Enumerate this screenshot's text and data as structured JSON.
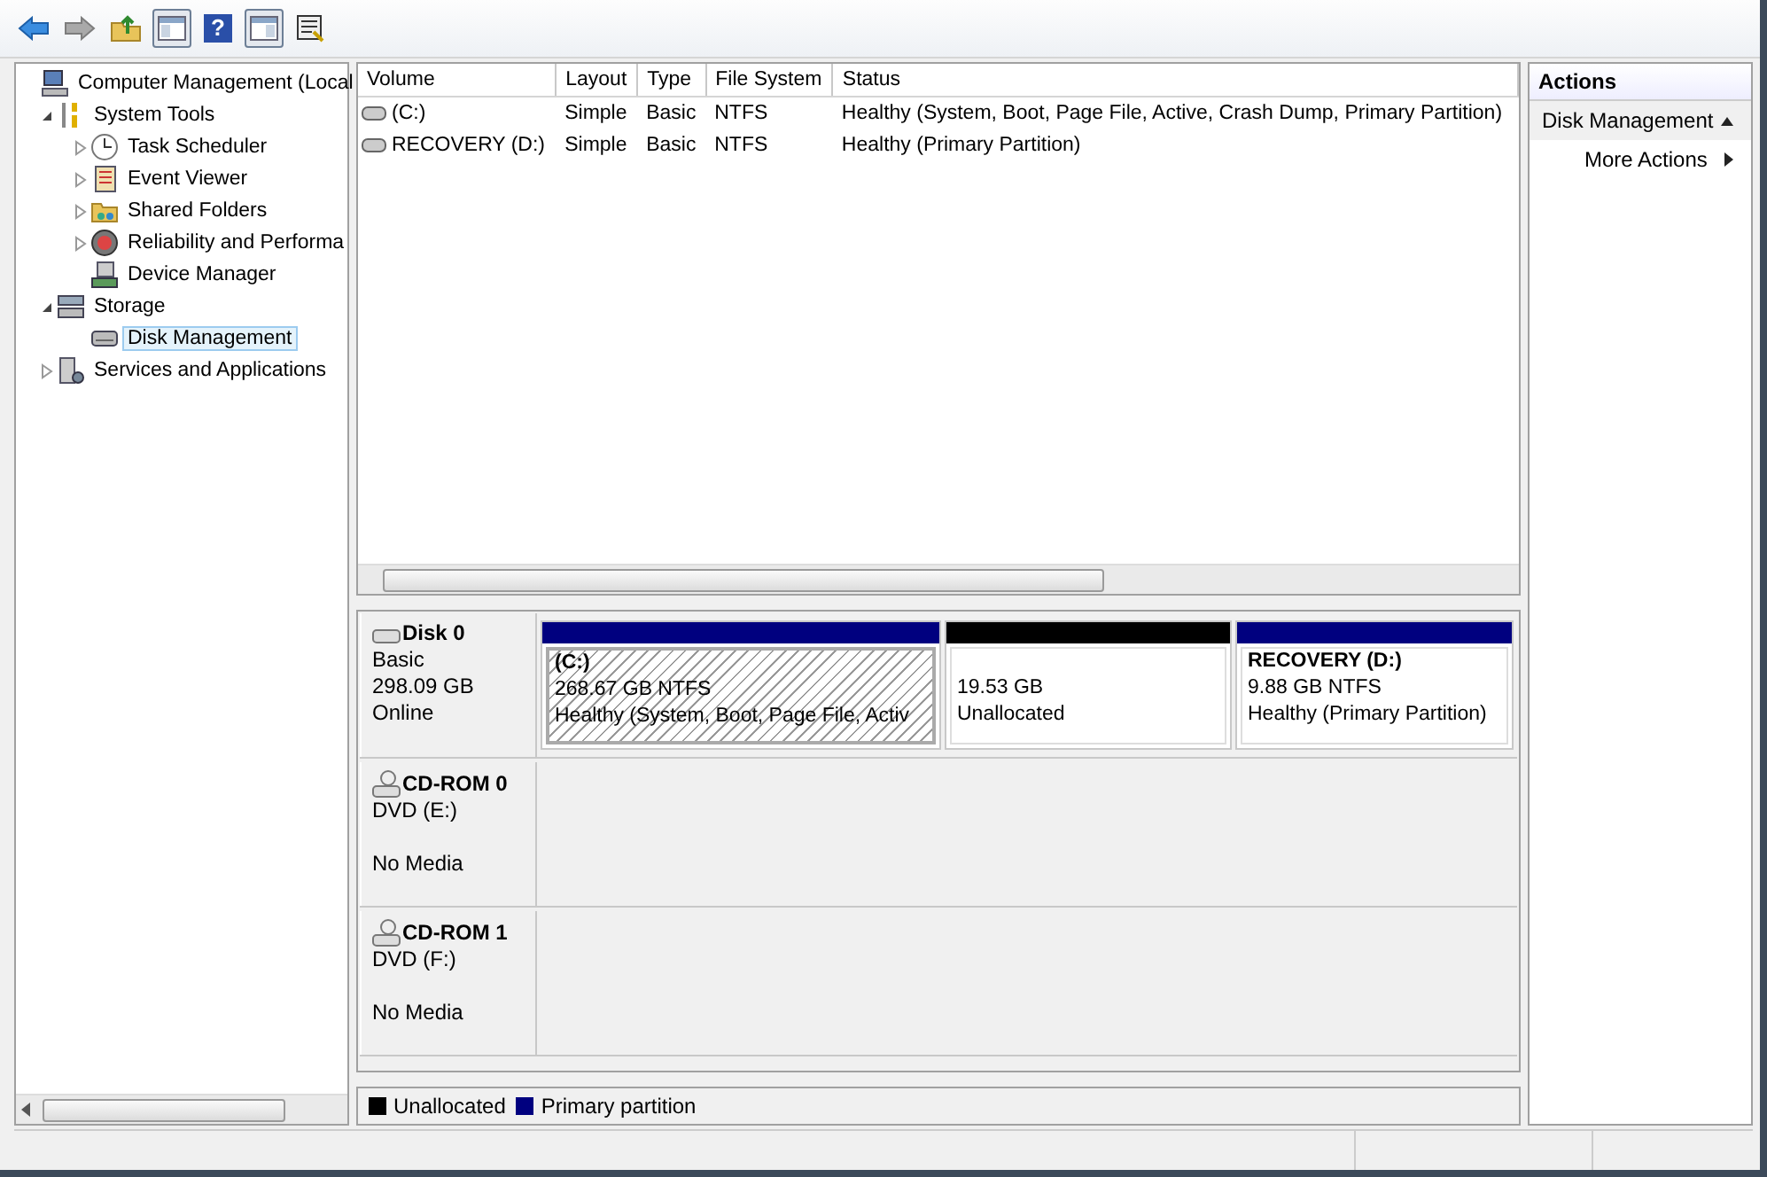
{
  "toolbar": {
    "buttons": [
      {
        "kind": "back",
        "pressed": false
      },
      {
        "kind": "forward",
        "pressed": false
      },
      {
        "kind": "up",
        "pressed": false
      },
      {
        "kind": "tree-toggle",
        "pressed": true
      },
      {
        "kind": "help",
        "pressed": false,
        "glyph": "?"
      },
      {
        "kind": "pane-toggle",
        "pressed": true
      },
      {
        "kind": "properties",
        "pressed": false
      }
    ]
  },
  "tree": {
    "items": [
      {
        "label": "Computer Management (Local",
        "kind": "computer",
        "selected": false,
        "children": [
          {
            "label": "System Tools",
            "kind": "tools",
            "expanded": true,
            "selected": false,
            "children": [
              {
                "label": "Task Scheduler",
                "kind": "clock",
                "expanded": false,
                "selected": false
              },
              {
                "label": "Event Viewer",
                "kind": "log",
                "expanded": false,
                "selected": false
              },
              {
                "label": "Shared Folders",
                "kind": "folder",
                "expanded": false,
                "selected": false
              },
              {
                "label": "Reliability and Performa",
                "kind": "gauge",
                "expanded": false,
                "selected": false
              },
              {
                "label": "Device Manager",
                "kind": "device",
                "selected": false
              }
            ]
          },
          {
            "label": "Storage",
            "kind": "storage",
            "expanded": true,
            "selected": false,
            "children": [
              {
                "label": "Disk Management",
                "kind": "disk",
                "selected": true
              }
            ]
          },
          {
            "label": "Services and Applications",
            "kind": "services",
            "expanded": false,
            "selected": false
          }
        ]
      }
    ]
  },
  "volumes": {
    "columns": [
      "Volume",
      "Layout",
      "Type",
      "File System",
      "Status"
    ],
    "rows": [
      [
        "(C:)",
        "Simple",
        "Basic",
        "NTFS",
        "Healthy (System, Boot, Page File, Active, Crash Dump, Primary Partition)"
      ],
      [
        "RECOVERY (D:)",
        "Simple",
        "Basic",
        "NTFS",
        "Healthy (Primary Partition)"
      ]
    ]
  },
  "disks": [
    {
      "kind": "disk",
      "name": "Disk 0",
      "lines": [
        "Basic",
        "298.09 GB"
      ],
      "state": "Online",
      "partitions": [
        {
          "color": "#00007f",
          "name": "(C:)",
          "size": "268.67 GB NTFS",
          "status": "Healthy (System, Boot, Page File, Activ",
          "selected": true
        },
        {
          "color": "#000000",
          "size": "19.53 GB",
          "status": "Unallocated",
          "selected": false
        },
        {
          "color": "#00007f",
          "name": "RECOVERY  (D:)",
          "size": "9.88 GB NTFS",
          "status": "Healthy (Primary Partition)",
          "selected": false
        }
      ]
    },
    {
      "kind": "cdrom",
      "name": "CD-ROM 0",
      "lines": [
        "DVD (E:)"
      ],
      "state": "No Media"
    },
    {
      "kind": "cdrom",
      "name": "CD-ROM 1",
      "lines": [
        "DVD (F:)"
      ],
      "state": "No Media"
    }
  ],
  "legend": [
    {
      "label": "Unallocated",
      "color": "#000000"
    },
    {
      "label": "Primary partition",
      "color": "#00007f"
    }
  ],
  "actions": {
    "title": "Actions",
    "items": [
      {
        "kind": "section",
        "label": "Disk Management"
      },
      {
        "kind": "item",
        "label": "More Actions"
      }
    ]
  }
}
